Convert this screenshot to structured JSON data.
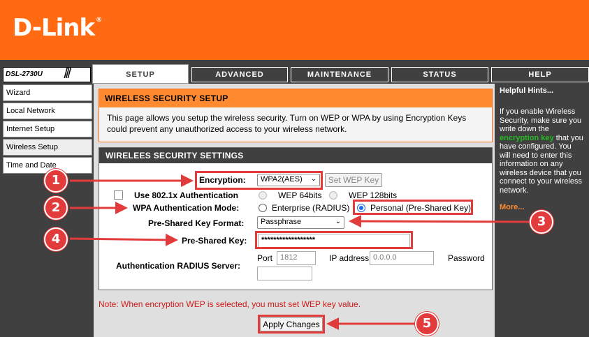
{
  "brand": {
    "logo": "D-Link",
    "trademark": "®",
    "model": "DSL-2730U",
    "slashes": "///"
  },
  "tabs": [
    {
      "label": "SETUP"
    },
    {
      "label": "ADVANCED"
    },
    {
      "label": "MAINTENANCE"
    },
    {
      "label": "STATUS"
    },
    {
      "label": "HELP"
    }
  ],
  "sidebar": {
    "items": [
      {
        "label": "Wizard"
      },
      {
        "label": "Local Network"
      },
      {
        "label": "Internet Setup"
      },
      {
        "label": "Wireless Setup"
      },
      {
        "label": "Time and Date"
      }
    ]
  },
  "intro": {
    "title": "WIRELESS SECURITY SETUP",
    "description": "This page allows you setup the wireless security. Turn on WEP or WPA by using Encryption Keys could prevent any unauthorized access to your wireless network."
  },
  "settings": {
    "title": "WIRELEES SECURITY SETTINGS",
    "encryption_label": "Encryption:",
    "encryption_value": "WPA2(AES)",
    "set_wep_key": "Set WEP Key",
    "use_8021x_label": "Use 802.1x Authentication",
    "wep64": "WEP 64bits",
    "wep128": "WEP 128bits",
    "wpa_mode_label": "WPA Authentication Mode:",
    "enterprise": "Enterprise (RADIUS)",
    "personal": "Personal (Pre-Shared Key)",
    "psk_format_label": "Pre-Shared Key Format:",
    "psk_format_value": "Passphrase",
    "psk_label": "Pre-Shared Key:",
    "psk_value": "******************",
    "radius_label": "Authentication RADIUS Server:",
    "port_label": "Port",
    "port_value": "1812",
    "ip_label": "IP address",
    "ip_value": "0.0.0.0",
    "password_label": "Password"
  },
  "note": "Note: When encryption WEP is selected, you must set WEP key value.",
  "apply_button": "Apply Changes",
  "hints": {
    "title": "Helpful Hints...",
    "text_before": "If you enable Wireless Security, make sure you write down the ",
    "highlight": "encryption key",
    "text_after": " that you have configured. You will need to enter this information on any wireless device that you connect to your wireless network.",
    "more": "More..."
  },
  "callouts": [
    "1",
    "2",
    "3",
    "4",
    "5"
  ],
  "colors": {
    "brand_orange": "#ff6a13",
    "callout_red": "#e23b3b",
    "dark_gray": "#404040"
  }
}
